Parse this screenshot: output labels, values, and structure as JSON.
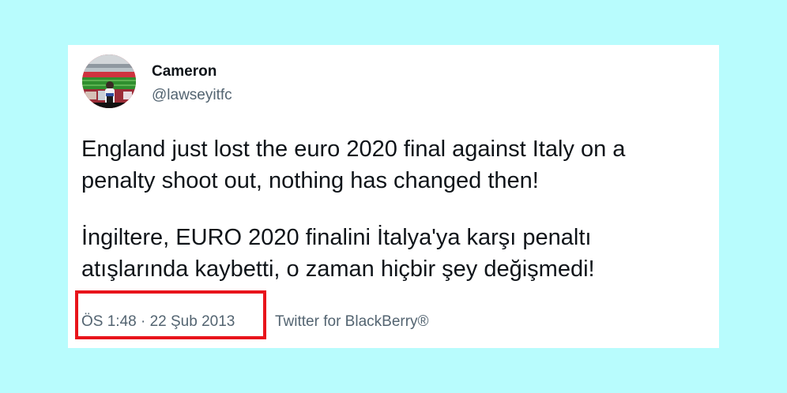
{
  "tweet": {
    "display_name": "Cameron",
    "handle": "@lawseyitfc",
    "text_en": "England just lost the euro 2020 final against Italy on a\npenalty shoot out, nothing has changed then!",
    "text_tr": "İngiltere, EURO 2020 finalini İtalya'ya karşı penaltı\natışlarında kaybetti, o zaman hiçbir şey değişmedi!",
    "timestamp": "ÖS 1:48 · 22 Şub 2013",
    "source": "Twitter for BlackBerry®"
  },
  "colors": {
    "page_background": "#b8fcfd",
    "card_background": "#ffffff",
    "highlight_border": "#e8141b",
    "secondary_text": "#536471",
    "primary_text": "#0f1419"
  },
  "icons": {
    "avatar": "stadium-photo-avatar"
  }
}
